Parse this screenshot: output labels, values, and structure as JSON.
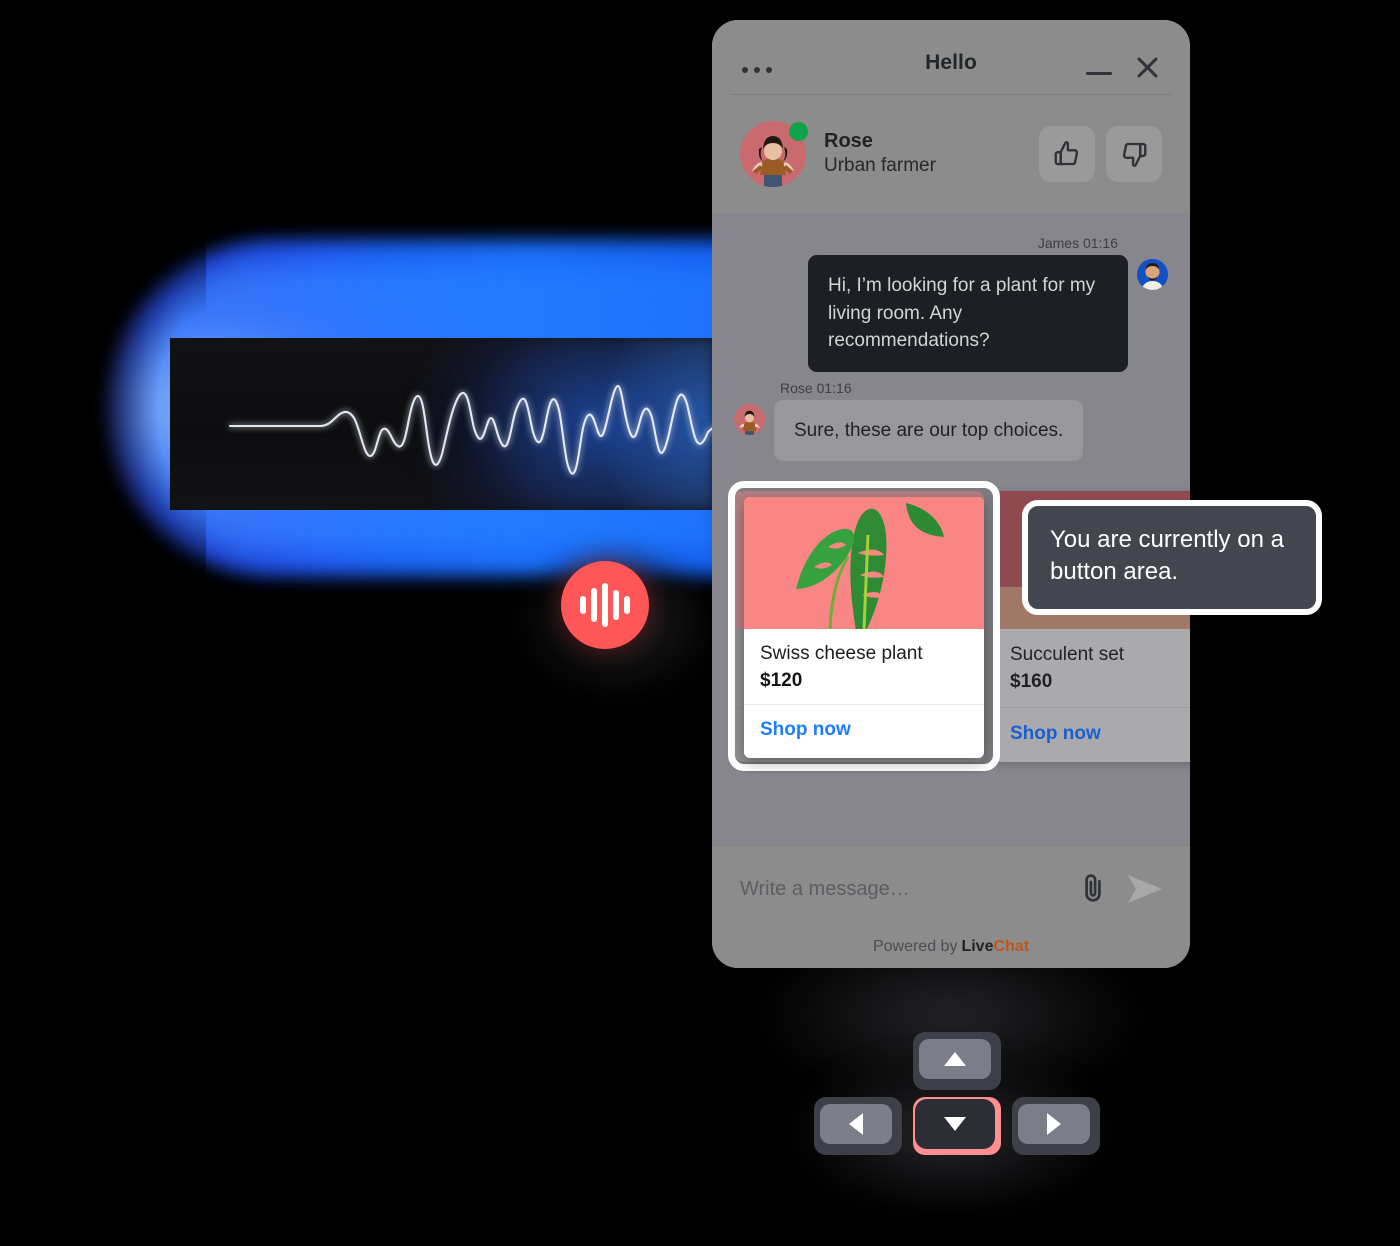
{
  "widget": {
    "title": "Hello",
    "menu_icon": "more-horizontal-icon",
    "minimize_icon": "minimize-icon",
    "close_icon": "close-icon"
  },
  "agent": {
    "name": "Rose",
    "role": "Urban farmer",
    "status": "online",
    "thumbs_up_icon": "thumbs-up-icon",
    "thumbs_down_icon": "thumbs-down-icon"
  },
  "conversation": [
    {
      "sender": "James",
      "time": "01:16",
      "meta": "James 01:16",
      "direction": "outgoing",
      "text": "Hi, I’m looking for a plant for my living room. Any recommendations?"
    },
    {
      "sender": "Rose",
      "time": "01:16",
      "meta": "Rose 01:16",
      "direction": "incoming",
      "text": "Sure, these are our top choices."
    }
  ],
  "products": [
    {
      "name": "Swiss cheese plant",
      "price": "$120",
      "cta": "Shop now",
      "image": "monstera-leaf-on-pink",
      "focused": true
    },
    {
      "name": "Succulent set",
      "price": "$160",
      "cta": "Shop now",
      "image": "succulent-set-photo",
      "focused": false
    }
  ],
  "tooltip": {
    "text": "You are currently on a button area."
  },
  "composer": {
    "placeholder": "Write a message…",
    "value": "",
    "attach_icon": "paperclip-icon",
    "send_icon": "send-arrow-icon"
  },
  "footer": {
    "prefix": "Powered by",
    "brand_first": "Live",
    "brand_second": "Chat"
  },
  "voice": {
    "record_icon": "audio-waveform-icon",
    "button_color": "#ff5757",
    "glow_color": "#1e6eff"
  },
  "keypad": {
    "up": "arrow-up-key",
    "down": "arrow-down-key",
    "left": "arrow-left-key",
    "right": "arrow-right-key",
    "active": "down",
    "active_color": "#ff8e8e"
  },
  "colors": {
    "widget_bg": "#8c8c8c",
    "messages_bg": "#86868c",
    "outgoing_bubble": "#1c1f23",
    "link": "#1f7dff",
    "online": "#11a34c",
    "tooltip_bg": "#43454f",
    "brand_accent": "#c2551b"
  }
}
